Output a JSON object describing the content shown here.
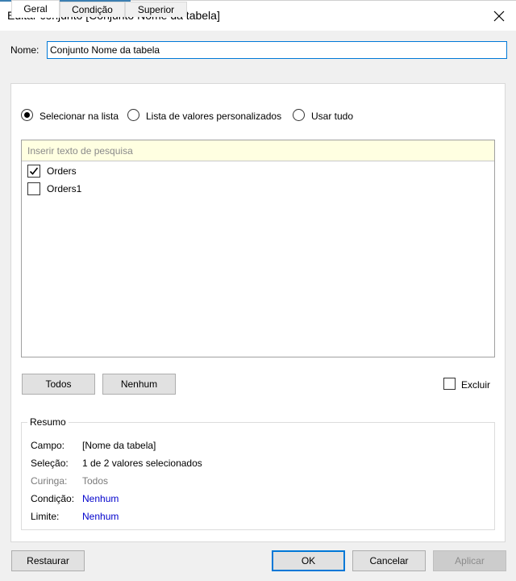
{
  "window": {
    "title": "Editar conjunto [Conjunto Nome da tabela]"
  },
  "name": {
    "label": "Nome:",
    "value": "Conjunto Nome da tabela"
  },
  "tabs": [
    {
      "label": "Geral",
      "active": true
    },
    {
      "label": "Condição",
      "active": false
    },
    {
      "label": "Superior",
      "active": false
    }
  ],
  "radios": [
    {
      "label": "Selecionar na lista",
      "selected": true
    },
    {
      "label": "Lista de valores personalizados",
      "selected": false
    },
    {
      "label": "Usar tudo",
      "selected": false
    }
  ],
  "list": {
    "search_placeholder": "Inserir texto de pesquisa",
    "items": [
      {
        "label": "Orders",
        "checked": true
      },
      {
        "label": "Orders1",
        "checked": false
      }
    ]
  },
  "buttons": {
    "all": "Todos",
    "none": "Nenhum",
    "exclude": "Excluir",
    "reset": "Restaurar",
    "ok": "OK",
    "cancel": "Cancelar",
    "apply": "Aplicar"
  },
  "summary": {
    "title": "Resumo",
    "rows": [
      {
        "label": "Campo:",
        "value": "[Nome da tabela]"
      },
      {
        "label": "Seleção:",
        "value": "1 de 2 valores selecionados"
      },
      {
        "label": "Curinga:",
        "value": "Todos"
      },
      {
        "label": "Condição:",
        "value": "Nenhum"
      },
      {
        "label": "Limite:",
        "value": "Nenhum"
      }
    ]
  },
  "colors": {
    "accent": "#0078d7",
    "link": "#0000cc",
    "search_bg": "#ffffe1"
  },
  "icons": [
    "close-icon",
    "checkmark-icon"
  ]
}
